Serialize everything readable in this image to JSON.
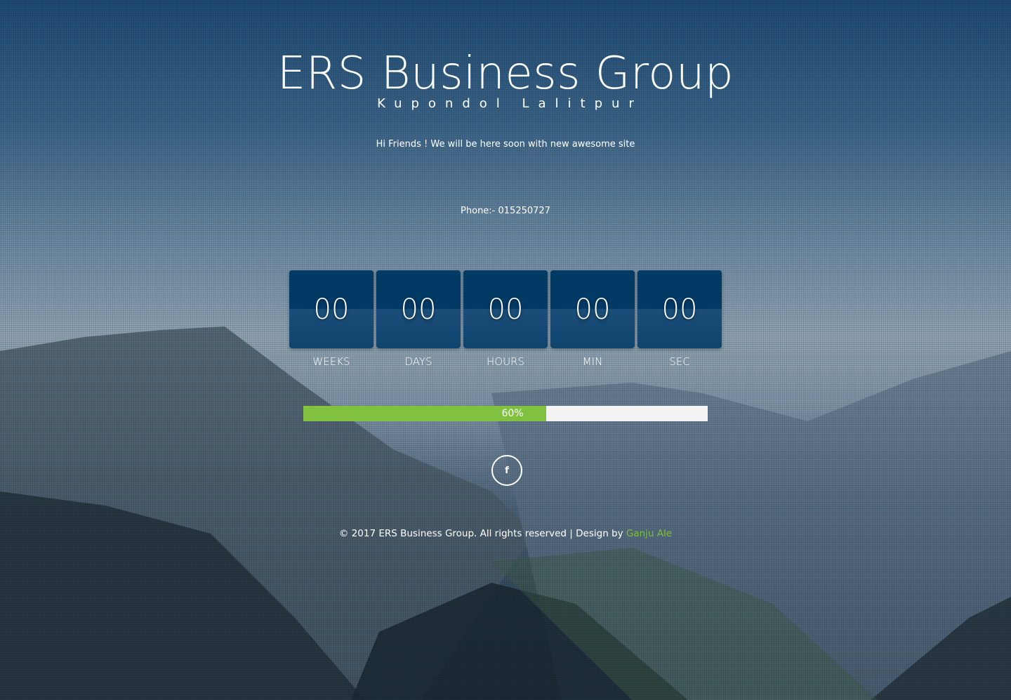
{
  "header": {
    "title": "ERS Business Group",
    "subtitle": "Kupondol Lalitpur"
  },
  "message": "Hi Friends ! We will be here soon with new awesome site",
  "phone": "Phone:- 015250727",
  "countdown": [
    {
      "value": "00",
      "label": "WEEKS"
    },
    {
      "value": "00",
      "label": "DAYS"
    },
    {
      "value": "00",
      "label": "HOURS"
    },
    {
      "value": "00",
      "label": "MIN"
    },
    {
      "value": "00",
      "label": "SEC"
    }
  ],
  "progress": {
    "percent": 60,
    "label": "60%",
    "color": "#80c240"
  },
  "social": {
    "facebook_icon": "f"
  },
  "footer": {
    "text": "© 2017 ERS Business Group. All rights reserved | Design by ",
    "designer": "Ganju Ale",
    "link_color": "#7cc13a"
  }
}
